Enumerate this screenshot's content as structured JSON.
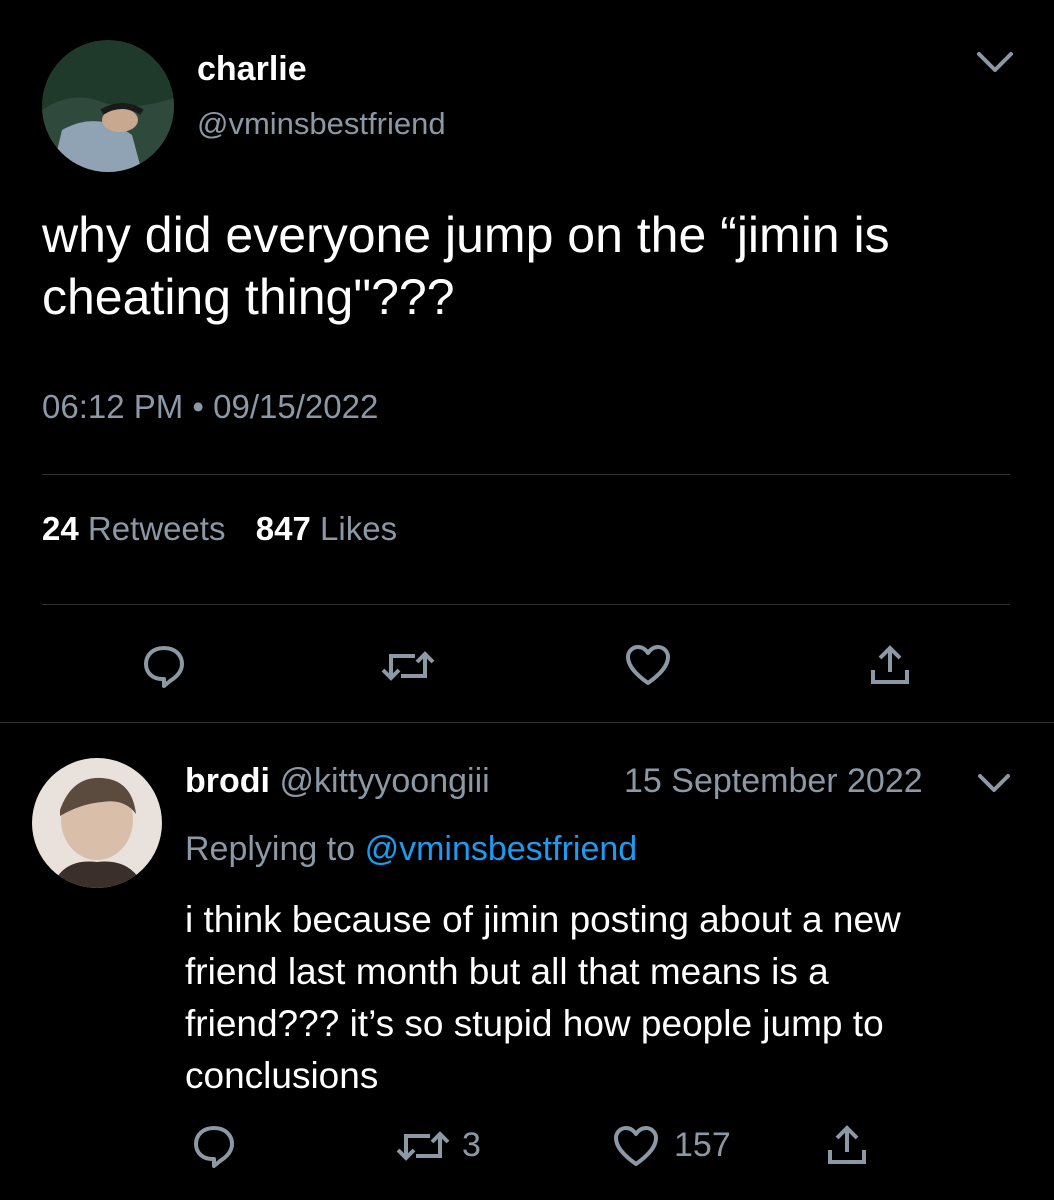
{
  "main_tweet": {
    "author_name": "charlie",
    "author_handle": "@vminsbestfriend",
    "text": "why did everyone jump on the “jimin is cheating thing\"???",
    "timestamp": "06:12 PM • 09/15/2022",
    "stats": {
      "retweets_count": "24",
      "retweets_label": "Retweets",
      "likes_count": "847",
      "likes_label": "Likes"
    }
  },
  "reply": {
    "author_name": "brodi",
    "author_handle": "@kittyyoongiii",
    "date": "15 September 2022",
    "replying_to_label": "Replying to",
    "replying_to_handle": "@vminsbestfriend",
    "text": "i think because of jimin posting about a new friend last month but all that means is a friend??? it’s so stupid how people jump to conclusions",
    "retweet_count": "3",
    "like_count": "157"
  },
  "colors": {
    "background": "#000000",
    "text": "#ffffff",
    "muted": "#8b98a5",
    "link": "#1d9bf0",
    "divider": "#2f3336"
  },
  "icons": [
    "chevron-down-icon",
    "reply-icon",
    "retweet-icon",
    "heart-icon",
    "share-icon"
  ]
}
